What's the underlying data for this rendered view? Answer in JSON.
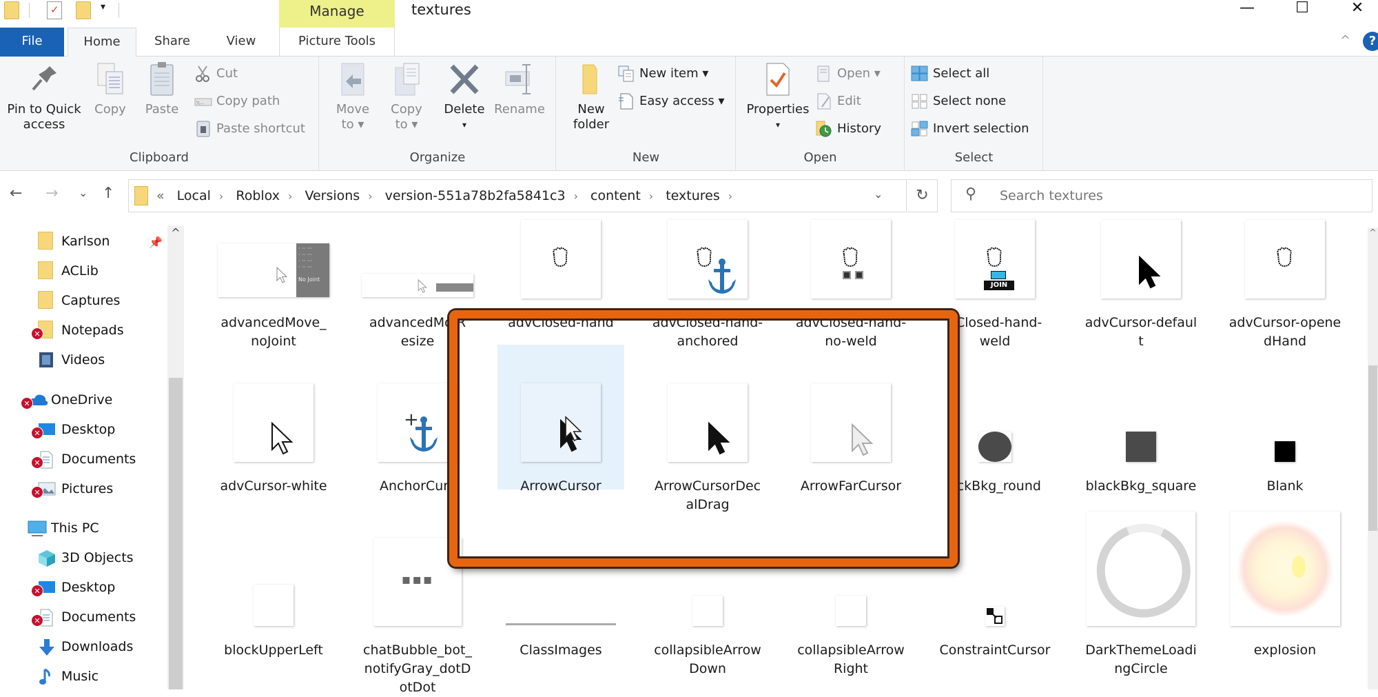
{
  "window": {
    "title": "textures",
    "context_tab_group": "Manage",
    "controls": {
      "minimize": "—",
      "maximize": "☐",
      "close": "✕"
    }
  },
  "quick_access_toolbar": {
    "icons": [
      "folder-icon",
      "properties-icon",
      "new-folder-icon"
    ],
    "dropdown": "▾"
  },
  "tabs": [
    {
      "label": "File",
      "active": false
    },
    {
      "label": "Home",
      "active": true
    },
    {
      "label": "Share",
      "active": false
    },
    {
      "label": "View",
      "active": false
    },
    {
      "label": "Picture Tools",
      "active": false
    }
  ],
  "ribbon": {
    "clipboard": {
      "label": "Clipboard",
      "pin": "Pin to Quick access",
      "pin_line1": "Pin to Quick",
      "pin_line2": "access",
      "copy": "Copy",
      "paste": "Paste",
      "cut": "Cut",
      "copy_path": "Copy path",
      "paste_shortcut": "Paste shortcut"
    },
    "organize": {
      "label": "Organize",
      "move_to_1": "Move",
      "move_to_2": "to ▾",
      "copy_to_1": "Copy",
      "copy_to_2": "to ▾",
      "delete": "Delete",
      "delete_arrow": "▾",
      "rename": "Rename"
    },
    "new": {
      "label": "New",
      "new_folder_1": "New",
      "new_folder_2": "folder",
      "new_item": "New item ▾",
      "easy_access": "Easy access ▾"
    },
    "open": {
      "label": "Open",
      "properties": "Properties",
      "properties_arrow": "▾",
      "open": "Open ▾",
      "edit": "Edit",
      "history": "History"
    },
    "select": {
      "label": "Select",
      "select_all": "Select all",
      "select_none": "Select none",
      "invert_selection": "Invert selection"
    },
    "collapse": "^",
    "help": "?"
  },
  "navigation": {
    "back": "←",
    "forward": "→",
    "recent": "⌄",
    "up": "↑",
    "breadcrumb_overflow": "«",
    "breadcrumbs": [
      "Local",
      "Roblox",
      "Versions",
      "version-551a78b2fa5841c3",
      "content",
      "textures"
    ],
    "separator": "›",
    "dropdown": "⌄",
    "refresh": "↻",
    "search_placeholder": "Search textures"
  },
  "sidebar": {
    "items": [
      {
        "label": "Karlson",
        "icon": "folder-icon",
        "pinned": true,
        "error": false
      },
      {
        "label": "ACLib",
        "icon": "folder-icon",
        "error": false
      },
      {
        "label": "Captures",
        "icon": "folder-icon",
        "error": false
      },
      {
        "label": "Notepads",
        "icon": "folder-icon",
        "error": true
      },
      {
        "label": "Videos",
        "icon": "video-icon",
        "error": false
      },
      {
        "label": "OneDrive",
        "icon": "cloud-icon",
        "error": true
      },
      {
        "label": "Desktop",
        "icon": "desktop-icon",
        "error": true
      },
      {
        "label": "Documents",
        "icon": "documents-icon",
        "error": true
      },
      {
        "label": "Pictures",
        "icon": "pictures-icon",
        "error": true
      },
      {
        "label": "This PC",
        "icon": "computer-icon",
        "error": false
      },
      {
        "label": "3D Objects",
        "icon": "cube-icon",
        "error": false
      },
      {
        "label": "Desktop",
        "icon": "desktop-icon",
        "error": true
      },
      {
        "label": "Documents",
        "icon": "documents-icon",
        "error": true
      },
      {
        "label": "Downloads",
        "icon": "download-icon",
        "error": false
      },
      {
        "label": "Music",
        "icon": "music-icon",
        "error": false
      }
    ],
    "error_glyph": "✕",
    "pin_glyph": "📌"
  },
  "files": [
    {
      "name": "advancedMove_noJoint",
      "label": "advancedMove_\nnoJoint"
    },
    {
      "name": "advancedMove_Resize",
      "label": "advancedMo R\nesize"
    },
    {
      "name": "advClosed-hand",
      "label": "advClosed-hand"
    },
    {
      "name": "advClosed-hand-anchored",
      "label": "advClosed-hand-\nanchored"
    },
    {
      "name": "advClosed-hand-no-weld",
      "label": "advClosed-hand-\nno-weld"
    },
    {
      "name": "advClosed-hand-weld",
      "label": "vClosed-hand-\nweld"
    },
    {
      "name": "advCursor-default",
      "label": "advCursor-defaul\nt"
    },
    {
      "name": "advCursor-openedHand",
      "label": "advCursor-opene\ndHand"
    },
    {
      "name": "advCursor-white",
      "label": "advCursor-white"
    },
    {
      "name": "AnchorCursor",
      "label": "AnchorCurs"
    },
    {
      "name": "ArrowCursor",
      "label": "ArrowCursor",
      "selected": true
    },
    {
      "name": "ArrowCursorDecalDrag",
      "label": "ArrowCursorDec\nalDrag"
    },
    {
      "name": "ArrowFarCursor",
      "label": "ArrowFarCursor"
    },
    {
      "name": "blackBkg_round",
      "label": "ackBkg_round"
    },
    {
      "name": "blackBkg_square",
      "label": "blackBkg_square"
    },
    {
      "name": "Blank",
      "label": "Blank"
    },
    {
      "name": "blockUpperLeft",
      "label": "blockUpperLeft"
    },
    {
      "name": "chatBubble_bot_notifyGray_dotDotDot",
      "label": "chatBubble_bot_\nnotifyGray_dotD\notDot"
    },
    {
      "name": "ClassImages",
      "label": "ClassImages"
    },
    {
      "name": "collapsibleArrowDown",
      "label": "collapsibleArrow\nDown"
    },
    {
      "name": "collapsibleArrowRight",
      "label": "collapsibleArrow\nRight"
    },
    {
      "name": "ConstraintCursor",
      "label": "ConstraintCursor"
    },
    {
      "name": "DarkThemeLoadingCircle",
      "label": "DarkThemeLoadi\nngCircle"
    },
    {
      "name": "explosion",
      "label": "explosion"
    }
  ],
  "thumb_glyphs": {
    "hand": "✊",
    "anchor": "⚓",
    "dots": "▪▪▪",
    "join_text": "JOIN",
    "no_joint_text": "No Joint"
  },
  "colors": {
    "file_tab": "#1a62b5",
    "manage_tab": "#eef08a",
    "highlight_border": "#e8650f",
    "selection": "#e5f1fb",
    "error_badge": "#c8102e",
    "folder": "#f6d77a"
  }
}
